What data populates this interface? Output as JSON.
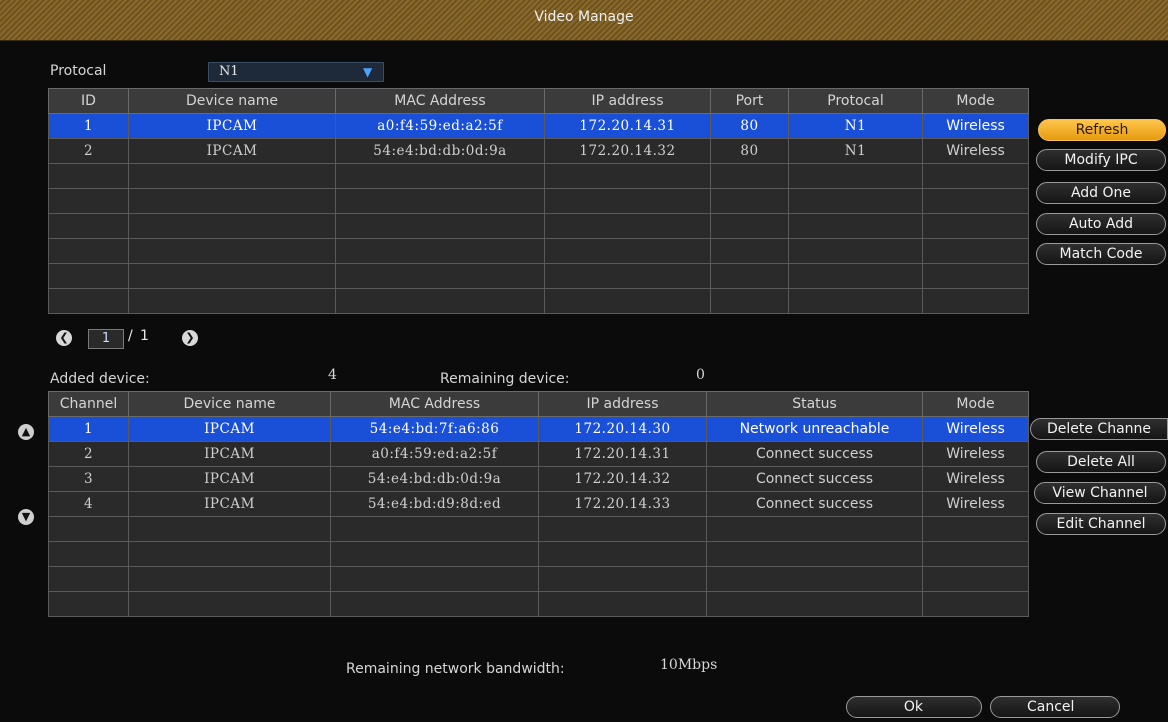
{
  "window": {
    "title": "Video Manage"
  },
  "protocol": {
    "label": "Protocal",
    "selected": "N1"
  },
  "top_table": {
    "headers": [
      "ID",
      "Device name",
      "MAC Address",
      "IP address",
      "Port",
      "Protocal",
      "Mode"
    ],
    "rows": [
      [
        "1",
        "IPCAM",
        "a0:f4:59:ed:a2:5f",
        "172.20.14.31",
        "80",
        "N1",
        "Wireless"
      ],
      [
        "2",
        "IPCAM",
        "54:e4:bd:db:0d:9a",
        "172.20.14.32",
        "80",
        "N1",
        "Wireless"
      ],
      [
        "",
        "",
        "",
        "",
        "",
        "",
        ""
      ],
      [
        "",
        "",
        "",
        "",
        "",
        "",
        ""
      ],
      [
        "",
        "",
        "",
        "",
        "",
        "",
        ""
      ],
      [
        "",
        "",
        "",
        "",
        "",
        "",
        ""
      ],
      [
        "",
        "",
        "",
        "",
        "",
        "",
        ""
      ],
      [
        "",
        "",
        "",
        "",
        "",
        "",
        ""
      ]
    ]
  },
  "top_buttons": [
    "Refresh",
    "Modify IPC",
    "Add One",
    "Auto Add",
    "Match Code"
  ],
  "pager": {
    "current": "1",
    "total": "1",
    "slash": "/",
    "prev_icon": "chevron-left-icon",
    "next_icon": "chevron-right-icon"
  },
  "summary": {
    "added_label": "Added device:",
    "added_value": "4",
    "remaining_label": "Remaining device:",
    "remaining_value": "0"
  },
  "bottom_table": {
    "headers": [
      "Channel",
      "Device name",
      "MAC Address",
      "IP address",
      "Status",
      "Mode"
    ],
    "rows": [
      [
        "1",
        "IPCAM",
        "54:e4:bd:7f:a6:86",
        "172.20.14.30",
        "Network unreachable",
        "Wireless"
      ],
      [
        "2",
        "IPCAM",
        "a0:f4:59:ed:a2:5f",
        "172.20.14.31",
        "Connect success",
        "Wireless"
      ],
      [
        "3",
        "IPCAM",
        "54:e4:bd:db:0d:9a",
        "172.20.14.32",
        "Connect success",
        "Wireless"
      ],
      [
        "4",
        "IPCAM",
        "54:e4:bd:d9:8d:ed",
        "172.20.14.33",
        "Connect success",
        "Wireless"
      ],
      [
        "",
        "",
        "",
        "",
        "",
        ""
      ],
      [
        "",
        "",
        "",
        "",
        "",
        ""
      ],
      [
        "",
        "",
        "",
        "",
        "",
        ""
      ],
      [
        "",
        "",
        "",
        "",
        "",
        ""
      ]
    ]
  },
  "bottom_buttons": [
    "Delete Channe",
    "Delete All",
    "View Channel",
    "Edit Channel"
  ],
  "scroll": {
    "up_icon": "arrow-up-icon",
    "down_icon": "arrow-down-icon"
  },
  "bandwidth": {
    "label": "Remaining network bandwidth:",
    "value": "10Mbps"
  },
  "footer": {
    "ok": "Ok",
    "cancel": "Cancel"
  },
  "colors": {
    "selection": "#1a4fd8",
    "accent_button": "#f0a820",
    "title_bar": "#7a5e26"
  }
}
